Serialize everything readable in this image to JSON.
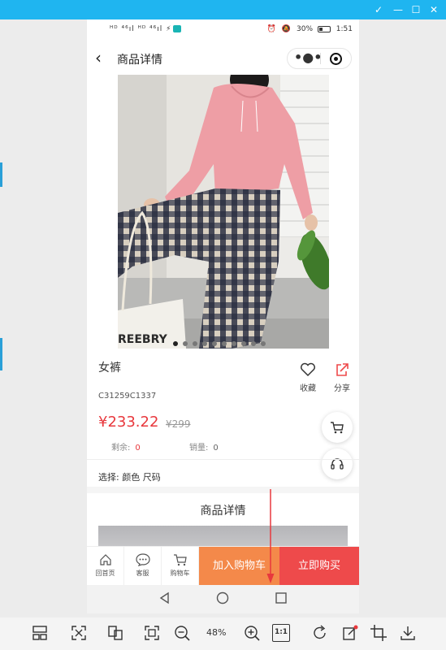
{
  "viewer": {
    "zoom": "48%",
    "toolbar_icons": [
      "layout-icon",
      "fit-screen-icon",
      "compare-icon",
      "fullscreen-icon",
      "zoom-out-icon",
      "zoom-in-icon",
      "actual-size-icon",
      "rotate-icon",
      "edit-icon",
      "crop-icon",
      "download-icon"
    ],
    "actual_size_label": "1:1"
  },
  "status_bar": {
    "left": "ᴴᴰ ⁴⁶ıl ᴴᴰ ⁴⁶ıl ⚡",
    "battery": "30%",
    "time": "1:51"
  },
  "nav": {
    "back_glyph": "‹",
    "title": "商品详情",
    "more_glyph": "•●•"
  },
  "product": {
    "image_overlay_text": "REEBRY",
    "carousel": {
      "count": 10,
      "active_index": 0
    },
    "name": "女裤",
    "sku": "C31259C1337",
    "price": "¥233.22",
    "original_price": "¥299",
    "remaining_label": "剩余:",
    "remaining_value": "0",
    "sales_label": "销量:",
    "sales_value": "0"
  },
  "actions": {
    "favorite_label": "收藏",
    "share_label": "分享"
  },
  "selection": {
    "text": "选择: 颜色 尺码"
  },
  "details": {
    "title": "商品详情"
  },
  "bottom_bar": {
    "home_label": "回首页",
    "service_label": "客服",
    "cart_label": "购物车",
    "add_to_cart": "加入购物车",
    "buy_now": "立即购买"
  },
  "colors": {
    "accent_red": "#e8383d",
    "orange": "#f4894a",
    "buy_red": "#ee4a4b",
    "viewer_blue": "#1fb5f0"
  }
}
